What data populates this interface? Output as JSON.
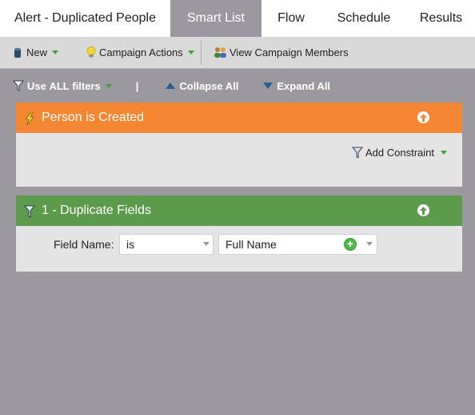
{
  "tabs": [
    {
      "label": "Alert - Duplicated People",
      "active": false
    },
    {
      "label": "Smart List",
      "active": true
    },
    {
      "label": "Flow",
      "active": false
    },
    {
      "label": "Schedule",
      "active": false
    },
    {
      "label": "Results",
      "active": false
    }
  ],
  "toolbar": {
    "new_label": "New",
    "campaign_actions_label": "Campaign Actions",
    "view_members_label": "View Campaign Members"
  },
  "filter_options": {
    "use_prefix": "Use ",
    "use_all": "ALL",
    "use_suffix": " filters",
    "divider": "|",
    "collapse_label": "Collapse All",
    "expand_label": "Expand All"
  },
  "trigger": {
    "title": "Person is Created",
    "color": "#f58733",
    "add_constraint_label": "Add Constraint"
  },
  "filter": {
    "title": "1 - Duplicate Fields",
    "color": "#5c9a4c",
    "field_label": "Field Name:",
    "operator_value": "is",
    "field_value": "Full Name",
    "plus_glyph": "+"
  },
  "colors": {
    "background": "#9b999f",
    "toolbar": "#d9d9d9",
    "accent_green": "#3aa53a"
  },
  "icons": {
    "new": "database-icon",
    "campaign_actions": "lightbulb-icon",
    "view_members": "people-icon",
    "filter": "funnel-icon",
    "collapse": "triangle-up-icon",
    "expand": "triangle-down-icon",
    "trigger": "lightning-icon",
    "move_up": "arrow-up-circle-icon",
    "close": "close-icon"
  }
}
